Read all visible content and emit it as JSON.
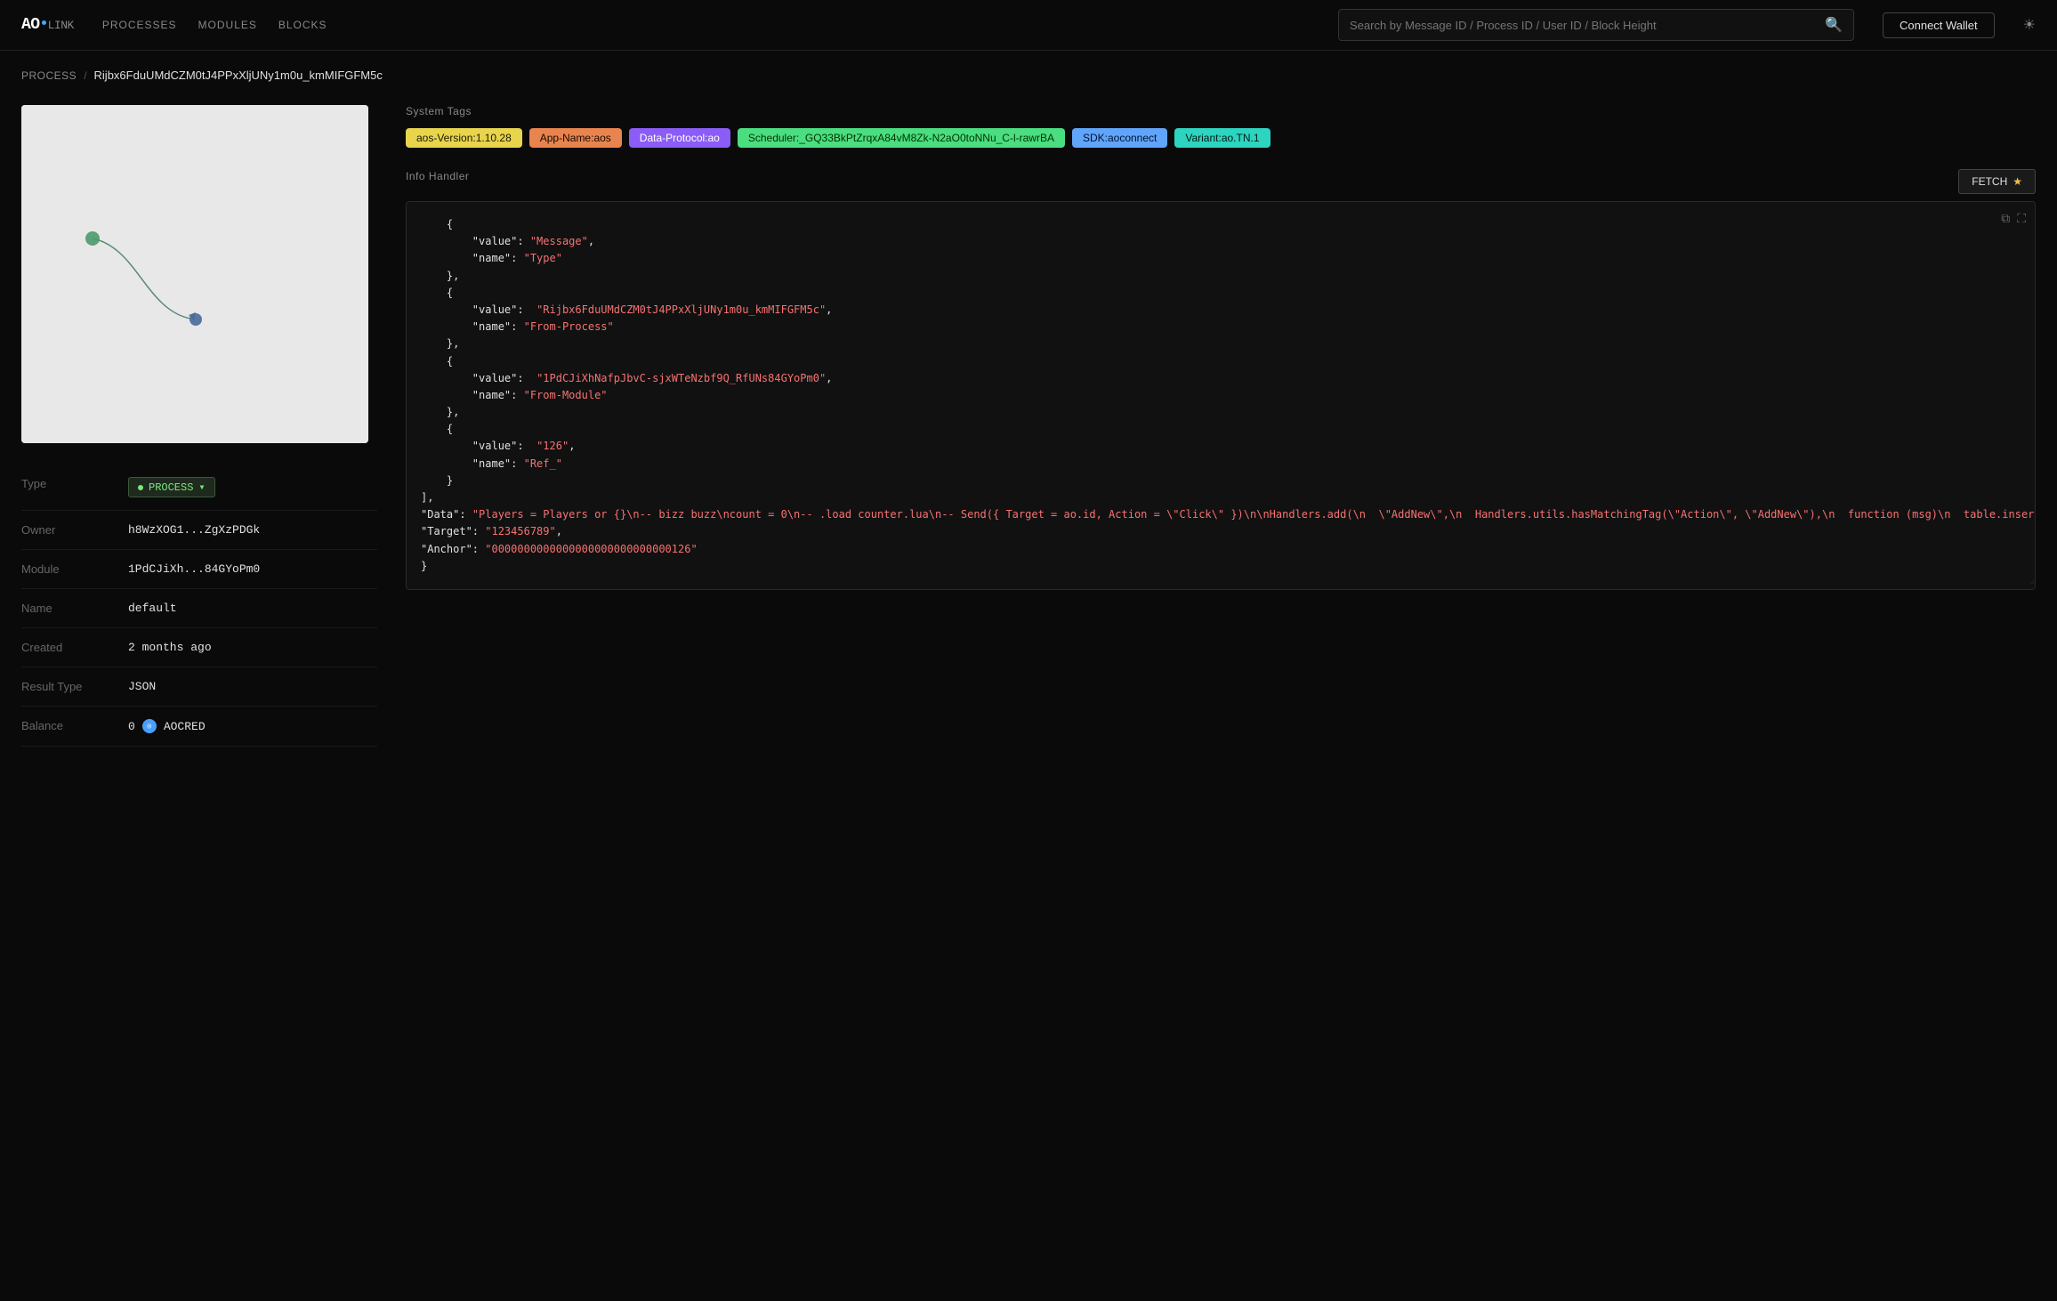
{
  "header": {
    "logo_ao": "AO",
    "logo_link": "LINK",
    "nav": [
      {
        "label": "PROCESSES",
        "id": "processes"
      },
      {
        "label": "MODULES",
        "id": "modules"
      },
      {
        "label": "BLOCKS",
        "id": "blocks"
      }
    ],
    "search_placeholder": "Search by Message ID / Process ID / User ID / Block Height",
    "connect_wallet_label": "Connect Wallet"
  },
  "breadcrumb": {
    "process_label": "PROCESS",
    "separator": "/",
    "process_id": "Rijbx6FduUMdCZM0tJ4PPxXljUNy1m0u_kmMIFGFM5c"
  },
  "metadata": {
    "type_label": "Type",
    "type_value": "PROCESS",
    "owner_label": "Owner",
    "owner_value": "h8WzXOG1...ZgXzPDGk",
    "module_label": "Module",
    "module_value": "1PdCJiXh...84GYoPm0",
    "name_label": "Name",
    "name_value": "default",
    "created_label": "Created",
    "created_value": "2 months ago",
    "result_type_label": "Result Type",
    "result_type_value": "JSON",
    "balance_label": "Balance",
    "balance_value": "0",
    "balance_currency": "AOCRED"
  },
  "system_tags": {
    "title": "System Tags",
    "tags": [
      {
        "label": "aos-Version:1.10.28",
        "color": "yellow"
      },
      {
        "label": "App-Name:aos",
        "color": "orange"
      },
      {
        "label": "Data-Protocol:ao",
        "color": "purple"
      },
      {
        "label": "Scheduler:_GQ33BkPtZrqxA84vM8Zk-N2aO0toNNu_C-l-rawrBA",
        "color": "green"
      },
      {
        "label": "SDK:aoconnect",
        "color": "blue"
      },
      {
        "label": "Variant:ao.TN.1",
        "color": "teal"
      }
    ]
  },
  "info_handler": {
    "title": "Info Handler",
    "fetch_label": "FETCH",
    "fetch_star": "★",
    "code_content": [
      "    {",
      "        \"value\": \"Message\",",
      "        \"name\": \"Type\"",
      "    },",
      "    {",
      "        \"value\":  \"Rijbx6FduUMdCZM0tJ4PPxXljUNy1m0u_kmMIFGFM5c\",",
      "        \"name\": \"From-Process\"",
      "    },",
      "    {",
      "        \"value\":  \"1PdCJiXhNafpJbvC-sjxWTeNzbf9Q_RfUNs84GYoPm0\",",
      "        \"name\": \"From-Module\"",
      "    },",
      "    {",
      "        \"value\":  \"126\",",
      "        \"name\": \"Ref_\"",
      "    }",
      "],",
      "\"Data\": \"Players = Players or {}\\n-- bizz buzz\\ncount = 0\\n-- .load counter.lua\\n-- Send({ Target = ao.id, Action = \\\"Click\\\" })\\n\\nHandlers.add(\\n  \\\"AddNew\\\",\\n  Handlers.utils.hasMatchingTag(\\\"Action\\\", \\\"AddNew\\\"),\\n  function (msg)\\n  table.insert(Players, msg.Data)\\n    count = #Players\\n    Handlers.utils.reply(\\\"bizz buzz\\\")(msg)\\n  end\\n)\\n\",",
      "\"Target\": \"123456789\",",
      "\"Anchor\": \"0000000000000000000000000000126\"",
      "}"
    ]
  }
}
